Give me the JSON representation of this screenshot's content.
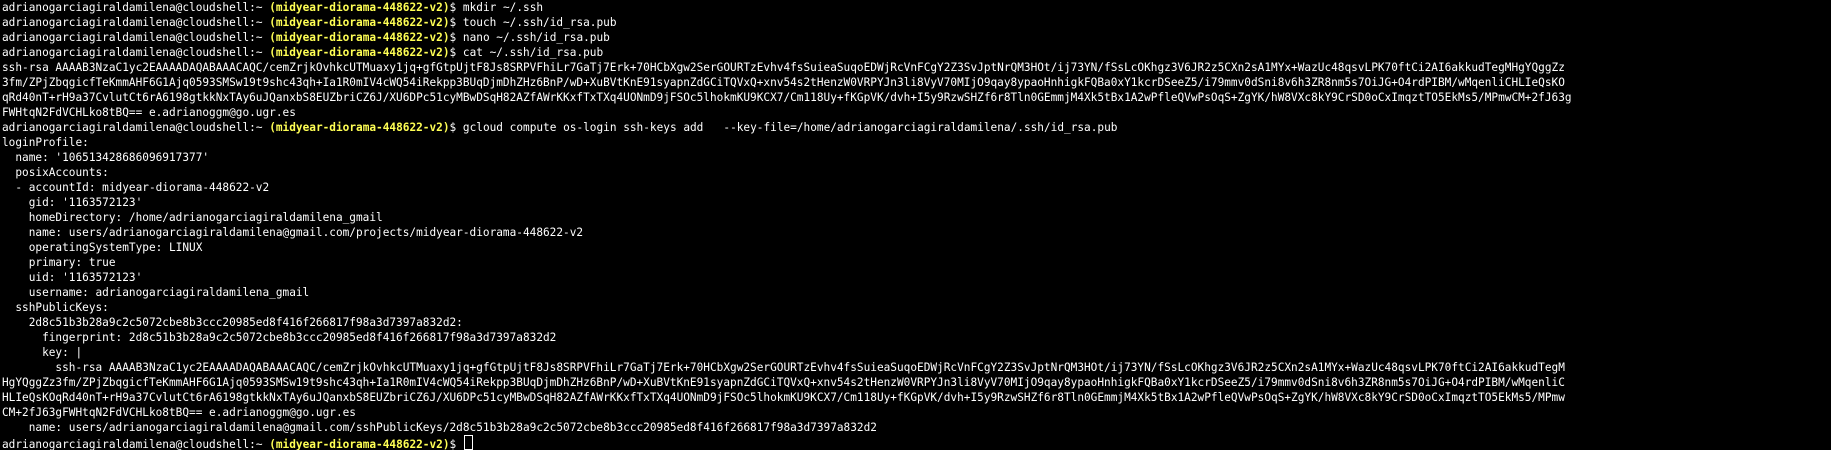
{
  "theme": {
    "background": "#000000",
    "text": "#ffffff",
    "project": "#ffff54"
  },
  "prompt": {
    "user_host": "adrianogarciagiraldamilena@cloudshell",
    "path": "~",
    "project": "(midyear-diorama-448622-v2)",
    "symbol": "$"
  },
  "lines": [
    {
      "type": "prompt",
      "cmd": "mkdir ~/.ssh"
    },
    {
      "type": "prompt",
      "cmd": "touch ~/.ssh/id_rsa.pub"
    },
    {
      "type": "prompt",
      "cmd": "nano ~/.ssh/id_rsa.pub"
    },
    {
      "type": "prompt",
      "cmd": "cat ~/.ssh/id_rsa.pub"
    },
    {
      "type": "out",
      "text": "ssh-rsa AAAAB3NzaC1yc2EAAAADAQABAAACAQC/cemZrjkOvhkcUTMuaxy1jq+gfGtpUjtF8Js8SRPVFhiLr7GaTj7Erk+70HCbXgw2SerGOURTzEvhv4fsSuieaSuqoEDWjRcVnFCgY2Z3SvJptNrQM3HOt/ij73YN/fSsLcOKhgz3V6JR2z5CXn2sA1MYx+WazUc48qsvLPK70ftCi2AI6akkudTegMHgYQggZz"
    },
    {
      "type": "out",
      "text": "3fm/ZPjZbqgicfTeKmmAHF6G1Ajq0593SMSw19t9shc43qh+Ia1R0mIV4cWQ54iRekpp3BUqDjmDhZHz6BnP/wD+XuBVtKnE91syapnZdGCiTQVxQ+xnv54s2tHenzW0VRPYJn3li8VyV70MIjO9qay8ypaoHnhigkFQBa0xY1kcrDSeeZ5/i79mmv0dSni8v6h3ZR8nm5s7OiJG+O4rdPIBM/wMqenliCHLIeQsKO"
    },
    {
      "type": "out",
      "text": "qRd40nT+rH9a37CvlutCt6rA6198gtkkNxTAy6uJQanxbS8EUZbriCZ6J/XU6DPc51cyMBwDSqH82AZfAWrKKxfTxTXq4UONmD9jFSOc5lhokmKU9KCX7/Cm118Uy+fKGpVK/dvh+I5y9RzwSHZf6r8Tln0GEmmjM4Xk5tBx1A2wPfleQVwPsOqS+ZgYK/hW8VXc8kY9CrSD0oCxImqztTO5EkMs5/MPmwCM+2fJ63g"
    },
    {
      "type": "out",
      "text": "FWHtqN2FdVCHLko8tBQ== e.adrianoggm@go.ugr.es"
    },
    {
      "type": "prompt",
      "cmd": "gcloud compute os-login ssh-keys add   --key-file=/home/adrianogarciagiraldamilena/.ssh/id_rsa.pub"
    },
    {
      "type": "out",
      "text": "loginProfile:"
    },
    {
      "type": "out",
      "text": "  name: '106513428686096917377'"
    },
    {
      "type": "out",
      "text": "  posixAccounts:"
    },
    {
      "type": "out",
      "text": "  - accountId: midyear-diorama-448622-v2"
    },
    {
      "type": "out",
      "text": "    gid: '1163572123'"
    },
    {
      "type": "out",
      "text": "    homeDirectory: /home/adrianogarciagiraldamilena_gmail"
    },
    {
      "type": "out",
      "text": "    name: users/adrianogarciagiraldamilena@gmail.com/projects/midyear-diorama-448622-v2"
    },
    {
      "type": "out",
      "text": "    operatingSystemType: LINUX"
    },
    {
      "type": "out",
      "text": "    primary: true"
    },
    {
      "type": "out",
      "text": "    uid: '1163572123'"
    },
    {
      "type": "out",
      "text": "    username: adrianogarciagiraldamilena_gmail"
    },
    {
      "type": "out",
      "text": "  sshPublicKeys:"
    },
    {
      "type": "out",
      "text": "    2d8c51b3b28a9c2c5072cbe8b3ccc20985ed8f416f266817f98a3d7397a832d2:"
    },
    {
      "type": "out",
      "text": "      fingerprint: 2d8c51b3b28a9c2c5072cbe8b3ccc20985ed8f416f266817f98a3d7397a832d2"
    },
    {
      "type": "out",
      "text": "      key: |"
    },
    {
      "type": "out",
      "text": "        ssh-rsa AAAAB3NzaC1yc2EAAAADAQABAAACAQC/cemZrjkOvhkcUTMuaxy1jq+gfGtpUjtF8Js8SRPVFhiLr7GaTj7Erk+70HCbXgw2SerGOURTzEvhv4fsSuieaSuqoEDWjRcVnFCgY2Z3SvJptNrQM3HOt/ij73YN/fSsLcOKhgz3V6JR2z5CXn2sA1MYx+WazUc48qsvLPK70ftCi2AI6akkudTegM"
    },
    {
      "type": "out",
      "text": "HgYQggZz3fm/ZPjZbqgicfTeKmmAHF6G1Ajq0593SMSw19t9shc43qh+Ia1R0mIV4cWQ54iRekpp3BUqDjmDhZHz6BnP/wD+XuBVtKnE91syapnZdGCiTQVxQ+xnv54s2tHenzW0VRPYJn3li8VyV70MIjO9qay8ypaoHnhigkFQBa0xY1kcrDSeeZ5/i79mmv0dSni8v6h3ZR8nm5s7OiJG+O4rdPIBM/wMqenliC"
    },
    {
      "type": "out",
      "text": "HLIeQsKOqRd40nT+rH9a37CvlutCt6rA6198gtkkNxTAy6uJQanxbS8EUZbriCZ6J/XU6DPc51cyMBwDSqH82AZfAWrKKxfTxTXq4UONmD9jFSOc5lhokmKU9KCX7/Cm118Uy+fKGpVK/dvh+I5y9RzwSHZf6r8Tln0GEmmjM4Xk5tBx1A2wPfleQVwPsOqS+ZgYK/hW8VXc8kY9CrSD0oCxImqztTO5EkMs5/MPmw"
    },
    {
      "type": "out",
      "text": "CM+2fJ63gFWHtqN2FdVCHLko8tBQ== e.adrianoggm@go.ugr.es"
    },
    {
      "type": "out",
      "text": "    name: users/adrianogarciagiraldamilena@gmail.com/sshPublicKeys/2d8c51b3b28a9c2c5072cbe8b3ccc20985ed8f416f266817f98a3d7397a832d2"
    },
    {
      "type": "active",
      "cmd": ""
    }
  ]
}
